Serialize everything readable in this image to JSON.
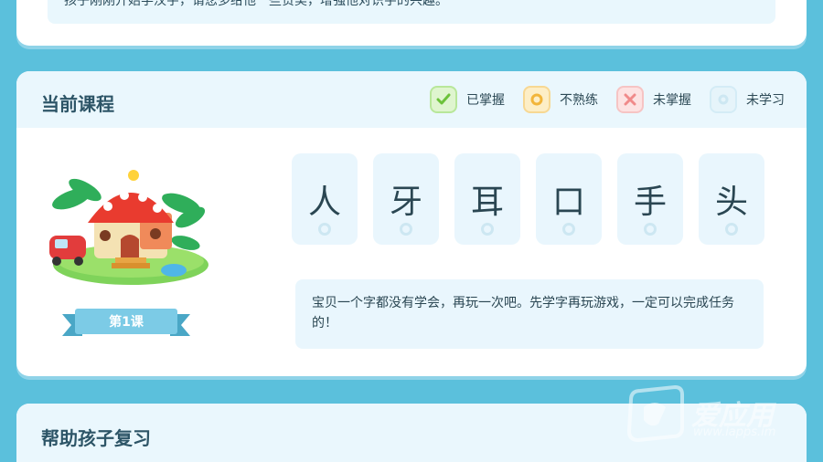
{
  "top_card": {
    "tip_text": "孩子刚刚开始学汉字，请您多给他一些赞美，增强他对识字的兴趣。"
  },
  "lesson_card": {
    "title": "当前课程",
    "legend": [
      {
        "label": "已掌握",
        "icon": "check-icon",
        "color": "#7ccf4a"
      },
      {
        "label": "不熟练",
        "icon": "ring-icon",
        "color": "#f2b53a"
      },
      {
        "label": "未掌握",
        "icon": "cross-icon",
        "color": "#f0898a"
      },
      {
        "label": "未学习",
        "icon": "circle-icon",
        "color": "#cde7f2"
      }
    ],
    "lesson_label": "第1课",
    "characters": [
      "人",
      "牙",
      "耳",
      "口",
      "手",
      "头"
    ],
    "message": "宝贝一个字都没有学会，再玩一次吧。先学字再玩游戏，一定可以完成任务的！"
  },
  "review_card": {
    "title": "帮助孩子复习"
  },
  "watermark": {
    "brand": "爱应用",
    "url": "www.iapps.im"
  },
  "colors": {
    "background": "#5bc0dc",
    "card": "#ffffff",
    "panel": "#e9f6fd",
    "title_text": "#2d5567"
  }
}
